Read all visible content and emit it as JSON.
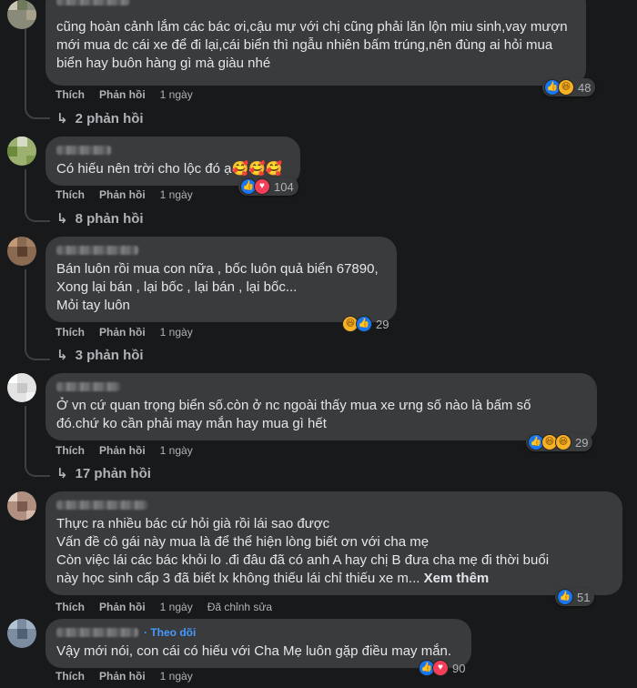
{
  "comments": [
    {
      "text": "cũng hoàn cảnh lắm các bác ơi,cậu mự với chị cũng phải lăn lộn miu sinh,vay mượn\nmới mua dc cái xe để đi lại,cái biển thì ngẫu nhiên bấm trúng,nên đùng ai hỏi mua\nbiển hay buôn hàng gì mà giàu nhé",
      "like": "Thích",
      "reply": "Phản hồi",
      "time": "1 ngày",
      "reactions": [
        "like",
        "haha"
      ],
      "reaction_count": "48",
      "replies": "2 phản hồi"
    },
    {
      "text": "Có hiếu nên trời cho lộc đó ạ🥰🥰🥰",
      "like": "Thích",
      "reply": "Phản hồi",
      "time": "1 ngày",
      "reactions": [
        "like",
        "love"
      ],
      "reaction_count": "104",
      "replies": "8 phản hồi"
    },
    {
      "text": "Bán luôn rồi mua con nữa , bốc luôn quả biển 67890,\nXong lại bán , lại bốc , lại bán , lại bốc...\nMỏi tay luôn",
      "like": "Thích",
      "reply": "Phản hồi",
      "time": "1 ngày",
      "reactions": [
        "haha",
        "like"
      ],
      "reaction_count": "29",
      "replies": "3 phản hồi"
    },
    {
      "text": "Ở vn cứ quan trọng biển số.còn ở nc ngoài thấy mua xe ưng số nào là bấm số\nđó.chứ ko cần phải may mắn hay mua gì hết",
      "like": "Thích",
      "reply": "Phản hồi",
      "time": "1 ngày",
      "reactions": [
        "like",
        "haha",
        "haha"
      ],
      "reaction_count": "29",
      "replies": "17 phản hồi"
    },
    {
      "text": "Thực ra nhiều bác cứ hỏi già rồi lái sao được\nVấn đề cô gái này mua là để thể hiện lòng biết ơn với cha mẹ\nCòn việc lái các bác khỏi lo .đi đâu đã có anh A hay chị B đưa cha mẹ đi thời buổi\nnày học sinh cấp 3 đã biết lx không thiếu lái chỉ thiếu xe m... ",
      "see_more": "Xem thêm",
      "like": "Thích",
      "reply": "Phản hồi",
      "time": "1 ngày",
      "edited": "Đã chỉnh sửa",
      "reactions": [
        "like"
      ],
      "reaction_count": "51"
    },
    {
      "follow": "Theo dõi",
      "text": "Vậy mới nói, con cái có hiếu với Cha Mẹ luôn gặp điều may mắn.",
      "like": "Thích",
      "reply": "Phản hồi",
      "time": "1 ngày",
      "reactions": [
        "like",
        "love"
      ],
      "reaction_count": "90"
    }
  ],
  "reaction_glyphs": {
    "like": "👍",
    "love": "♥",
    "haha": "😆",
    "care": "🥰"
  },
  "reply_arrow": "↳",
  "colors": {
    "bg": "#18191a",
    "bubble": "#3a3b3c",
    "text": "#e4e6eb",
    "muted": "#b0b3b8",
    "link": "#4599ff",
    "like": "#1877f2",
    "love": "#f33e58",
    "haha": "#f7b125"
  }
}
